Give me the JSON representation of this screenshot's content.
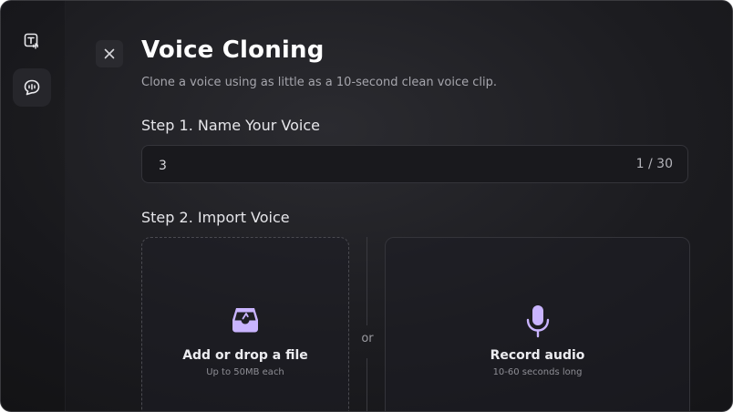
{
  "dialog": {
    "title": "Voice Cloning",
    "subtitle": "Clone a voice using as little as a 10-second clean voice clip."
  },
  "step1": {
    "label": "Step 1. Name Your Voice",
    "name_value": "3",
    "char_count": "1 / 30"
  },
  "step2": {
    "label": "Step 2. Import Voice",
    "separator": "or",
    "upload": {
      "title": "Add or drop a file",
      "subtitle": "Up to 50MB each"
    },
    "record": {
      "title": "Record audio",
      "subtitle": "10-60 seconds long"
    }
  },
  "sidebar": {
    "items": [
      {
        "icon": "text-to-speech-icon",
        "active": false
      },
      {
        "icon": "voice-chat-icon",
        "active": true
      }
    ]
  },
  "colors": {
    "accent": "#c9b4ff",
    "background": "#1c1c20",
    "text_primary": "#ffffff",
    "text_secondary": "#a6a6ad"
  }
}
